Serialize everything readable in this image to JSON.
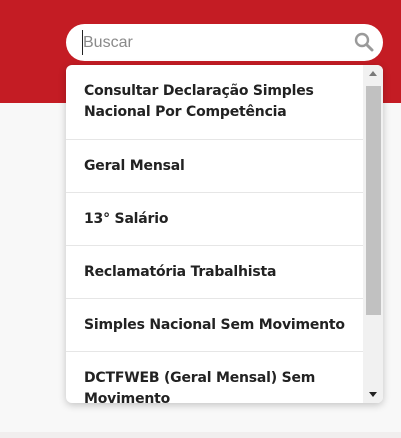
{
  "search": {
    "placeholder": "Buscar",
    "icon": "search-icon"
  },
  "dropdown": {
    "items": [
      {
        "label": "Consultar Declaração Simples Nacional Por Competência"
      },
      {
        "label": "Geral Mensal"
      },
      {
        "label": "13° Salário"
      },
      {
        "label": "Reclamatória Trabalhista"
      },
      {
        "label": "Simples Nacional Sem Movimento"
      },
      {
        "label": "DCTFWEB (Geral Mensal) Sem Movimento"
      }
    ]
  },
  "colors": {
    "header": "#c41c24",
    "background": "#f8f8f8",
    "text": "#222222",
    "scroll_thumb": "#c1c1c1"
  }
}
